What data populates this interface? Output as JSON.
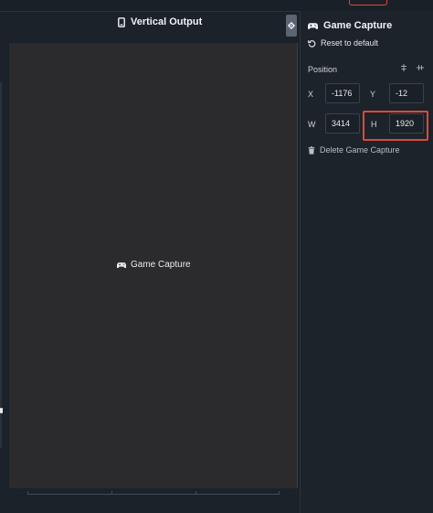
{
  "preview": {
    "title": "Vertical Output",
    "canvas_label": "Game Capture",
    "icons": {
      "title": "vertical-monitor-icon",
      "settings": "gear-icon",
      "source": "gamepad-icon"
    }
  },
  "panel": {
    "title": "Game Capture",
    "reset_label": "Reset to default",
    "position_label": "Position",
    "fields": {
      "x": {
        "label": "X",
        "value": "-1176"
      },
      "y": {
        "label": "Y",
        "value": "-12"
      },
      "w": {
        "label": "W",
        "value": "3414"
      },
      "h": {
        "label": "H",
        "value": "1920"
      }
    },
    "delete_label": "Delete Game Capture",
    "icons": {
      "title": "gamepad-icon",
      "reset": "undo-icon",
      "align_a": "align-center-icon",
      "align_b": "align-middle-icon",
      "delete": "trash-icon"
    }
  },
  "colors": {
    "highlight": "#e0483a",
    "canvas": "#2b2b2e",
    "panel": "#1c232a"
  }
}
